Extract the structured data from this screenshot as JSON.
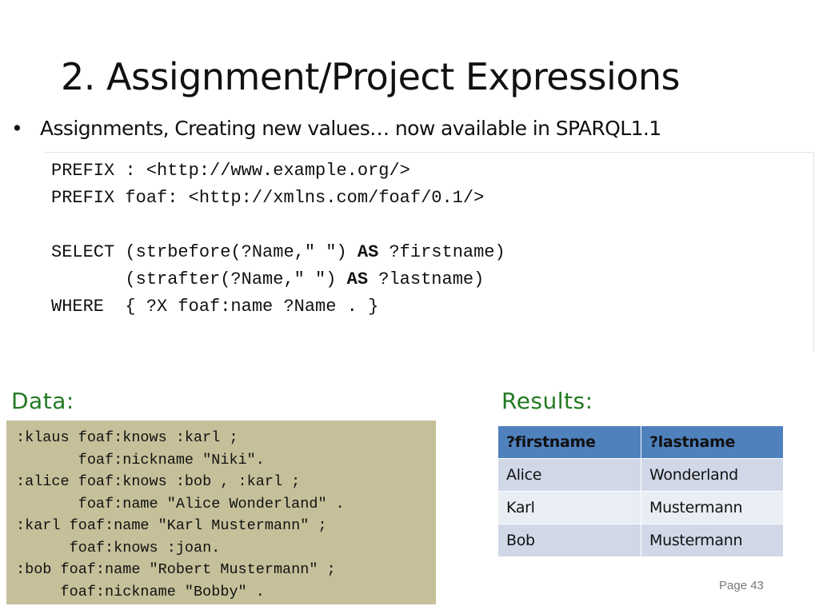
{
  "slide": {
    "title": "2. Assignment/Project Expressions",
    "bullet_marker": "•",
    "bullet_text": "Assignments, Creating new values… now available in SPARQL1.1",
    "page_label": "Page 43"
  },
  "query": {
    "line1": "PREFIX : <http://www.example.org/>",
    "line2": "PREFIX foaf: <http://xmlns.com/foaf/0.1/>",
    "line3_a": "SELECT (strbefore(?Name,\" \") ",
    "line3_kw": "AS",
    "line3_b": " ?firstname)",
    "line4_a": "       (strafter(?Name,\" \") ",
    "line4_kw": "AS",
    "line4_b": " ?lastname)",
    "line5": "WHERE  { ?X foaf:name ?Name . }"
  },
  "data_section": {
    "label": "Data:",
    "lines": [
      ":klaus foaf:knows :karl ;",
      "       foaf:nickname \"Niki\".",
      ":alice foaf:knows :bob , :karl ;",
      "       foaf:name \"Alice Wonderland\" .",
      ":karl foaf:name \"Karl Mustermann\" ;",
      "      foaf:knows :joan.",
      ":bob foaf:name \"Robert Mustermann\" ;",
      "     foaf:nickname \"Bobby\" ."
    ]
  },
  "results_section": {
    "label": "Results:",
    "headers": [
      "?firstname",
      "?lastname"
    ],
    "rows": [
      [
        "Alice",
        "Wonderland"
      ],
      [
        "Karl",
        "Mustermann"
      ],
      [
        "Bob",
        "Mustermann"
      ]
    ]
  },
  "colors": {
    "section_label": "#237a23",
    "data_box_bg": "#c6c09a",
    "table_header_bg": "#4f81bd",
    "table_row_odd": "#d0d8e8",
    "table_row_even": "#e9edf4"
  }
}
